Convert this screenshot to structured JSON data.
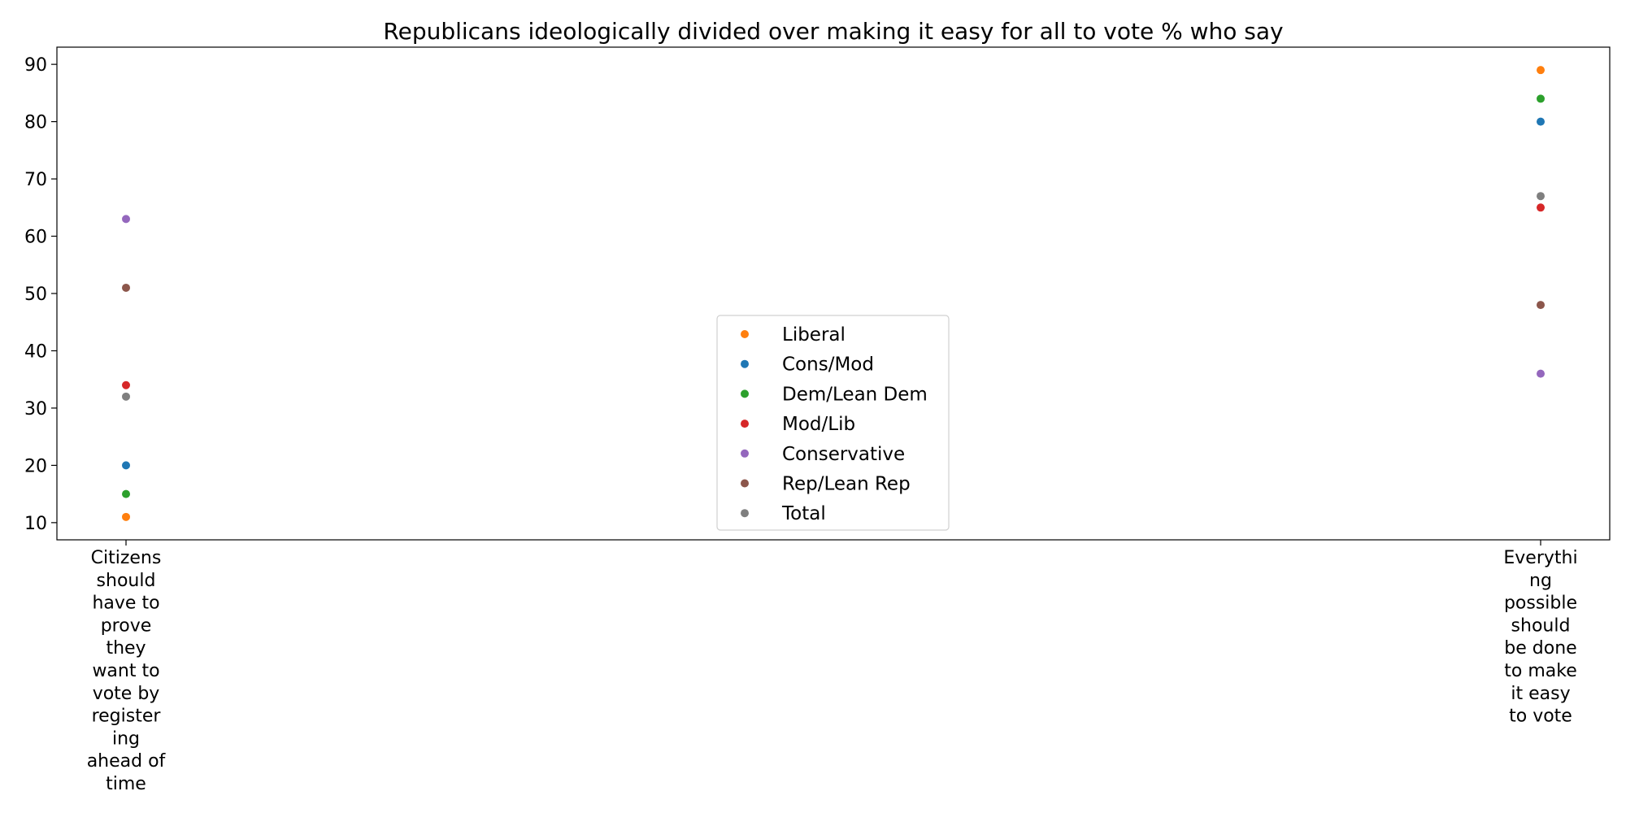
{
  "chart_data": {
    "type": "scatter",
    "title": "Republicans ideologically divided over making it easy for all to vote % who say",
    "xlabel": "",
    "ylabel": "",
    "categories": [
      [
        "Citizens",
        "should",
        "have to",
        "prove",
        "they",
        "want to",
        "vote by",
        "register",
        "ing",
        "ahead of",
        "time"
      ],
      [
        "Everythi",
        "ng",
        "possible",
        "should",
        "be done",
        "to make",
        "it easy",
        "to vote"
      ]
    ],
    "yticks": [
      "10",
      "20",
      "30",
      "40",
      "50",
      "60",
      "70",
      "80",
      "90"
    ],
    "ylim": [
      7,
      93
    ],
    "grid": false,
    "legend_placement": "lower-center",
    "series": [
      {
        "name": "Liberal",
        "color": "#ff7f0e",
        "values": [
          11,
          89
        ]
      },
      {
        "name": "Cons/Mod",
        "color": "#1f77b4",
        "values": [
          20,
          80
        ]
      },
      {
        "name": "Dem/Lean Dem",
        "color": "#2ca02c",
        "values": [
          15,
          84
        ]
      },
      {
        "name": "Mod/Lib",
        "color": "#d62728",
        "values": [
          34,
          65
        ]
      },
      {
        "name": "Conservative",
        "color": "#9467bd",
        "values": [
          63,
          36
        ]
      },
      {
        "name": "Rep/Lean Rep",
        "color": "#8c564b",
        "values": [
          51,
          48
        ]
      },
      {
        "name": "Total",
        "color": "#7f7f7f",
        "values": [
          32,
          67
        ]
      }
    ]
  }
}
